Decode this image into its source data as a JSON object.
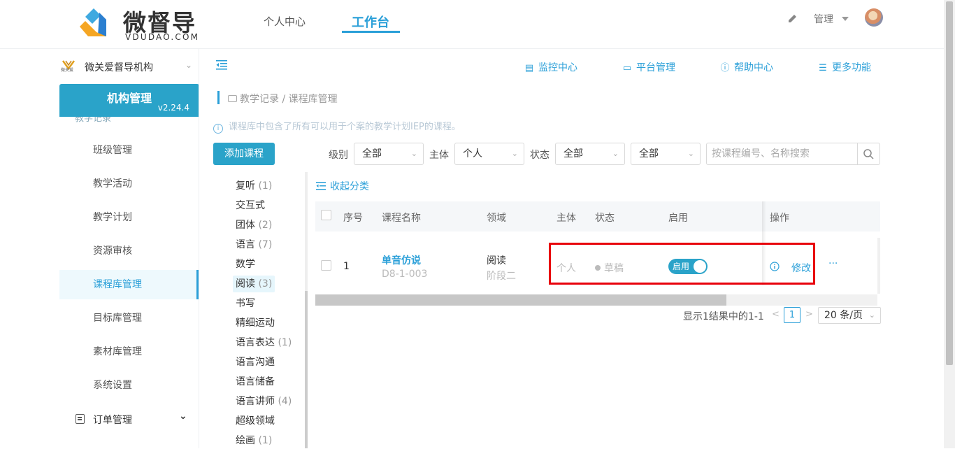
{
  "header": {
    "logo_text": "微督导",
    "logo_sub": "VDUDAO.COM",
    "nav": [
      {
        "label": "个人中心"
      },
      {
        "label": "工作台"
      }
    ],
    "admin_label": "管理"
  },
  "sidebar": {
    "org_name": "微关爱督导机构",
    "org_logo_text": "微关爱",
    "section_title": "机构管理",
    "version": "v2.24.4",
    "hidden_group": "教学记录",
    "items": [
      {
        "label": "班级管理"
      },
      {
        "label": "教学活动"
      },
      {
        "label": "教学计划"
      },
      {
        "label": "资源审核"
      },
      {
        "label": "课程库管理"
      },
      {
        "label": "目标库管理"
      },
      {
        "label": "素材库管理"
      },
      {
        "label": "系统设置"
      }
    ],
    "order_group": "订单管理"
  },
  "toolbar": {
    "links": [
      {
        "label": "监控中心"
      },
      {
        "label": "平台管理"
      },
      {
        "label": "帮助中心"
      },
      {
        "label": "更多功能"
      }
    ]
  },
  "breadcrumb": "教学记录 / 课程库管理",
  "info_text": "课程库中包含了所有可以用于个案的教学计划IEP的课程。",
  "filters": {
    "add_button": "添加课程",
    "level_label": "级别",
    "level_value": "全部",
    "subject_label": "主体",
    "subject_value": "个人",
    "status_label": "状态",
    "status_value": "全部",
    "extra_value": "全部",
    "search_placeholder": "按课程编号、名称搜索"
  },
  "categories": [
    {
      "name": "复听",
      "count": "(1)"
    },
    {
      "name": "交互式",
      "count": ""
    },
    {
      "name": "团体",
      "count": "(2)"
    },
    {
      "name": "语言",
      "count": "(7)"
    },
    {
      "name": "数学",
      "count": ""
    },
    {
      "name": "阅读",
      "count": "(3)"
    },
    {
      "name": "书写",
      "count": ""
    },
    {
      "name": "精细运动",
      "count": ""
    },
    {
      "name": "语言表达",
      "count": "(1)"
    },
    {
      "name": "语言沟通",
      "count": ""
    },
    {
      "name": "语言储备",
      "count": ""
    },
    {
      "name": "语言讲师",
      "count": "(4)"
    },
    {
      "name": "超级领域",
      "count": ""
    },
    {
      "name": "绘画",
      "count": "(1)"
    }
  ],
  "collapse_label": "收起分类",
  "table": {
    "headers": [
      "序号",
      "课程名称",
      "领域",
      "主体",
      "状态",
      "启用",
      "操作"
    ],
    "rows": [
      {
        "index": "1",
        "name": "单音仿说",
        "code": "D8-1-003",
        "domain": "阅读",
        "stage": "阶段二",
        "subject": "个人",
        "status": "草稿",
        "enabled_label": "启用",
        "edit_label": "修改",
        "more": "···"
      }
    ]
  },
  "pagination": {
    "summary": "显示1结果中的1-1",
    "current": "1",
    "page_size": "20 条/页"
  },
  "colors": {
    "accent": "#2aa3c9",
    "link": "#2a9fd8",
    "highlight": "#e8000b"
  }
}
